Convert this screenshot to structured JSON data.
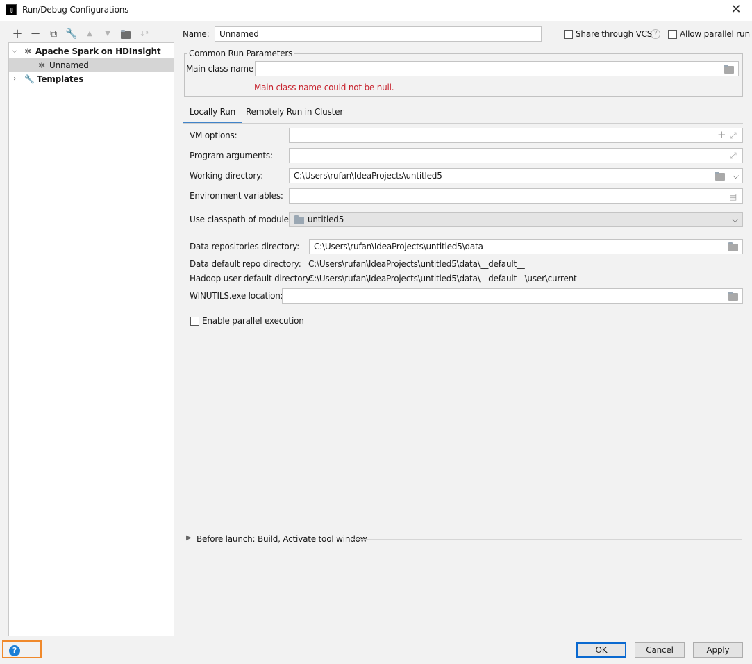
{
  "window": {
    "title": "Run/Debug Configurations",
    "app_icon_text": "IJ",
    "close_glyph": "✕"
  },
  "toolbar": {
    "icons": [
      "add-icon",
      "remove-icon",
      "copy-icon",
      "wrench-icon",
      "move-up-icon",
      "move-down-icon",
      "new-folder-icon",
      "sort-icon"
    ]
  },
  "tree": {
    "items": [
      {
        "label": "Apache Spark on HDInsight",
        "expanded": true
      },
      {
        "label": "Unnamed",
        "selected": true
      },
      {
        "label": "Templates",
        "expanded": false
      }
    ]
  },
  "header": {
    "name_label": "Name:",
    "name_value": "Unnamed",
    "share_vcs_label": "Share through VCS",
    "allow_parallel_label": "Allow parallel run"
  },
  "common": {
    "group_title": "Common Run Parameters",
    "main_class_label": "Main class name",
    "main_class_value": "",
    "error": "Main class name could not be null."
  },
  "tabs": [
    {
      "label": "Locally Run",
      "active": true
    },
    {
      "label": "Remotely Run in Cluster",
      "active": false
    }
  ],
  "local": {
    "vm_options_label": "VM options:",
    "vm_options_value": "",
    "program_args_label": "Program arguments:",
    "program_args_value": "",
    "working_dir_label": "Working directory:",
    "working_dir_value": "C:\\Users\\rufan\\IdeaProjects\\untitled5",
    "env_vars_label": "Environment variables:",
    "env_vars_value": "",
    "classpath_label": "Use classpath of module:",
    "classpath_value": "untitled5",
    "data_repo_label": "Data repositories directory:",
    "data_repo_value": "C:\\Users\\rufan\\IdeaProjects\\untitled5\\data",
    "data_default_label": "Data default repo directory:",
    "data_default_value": "C:\\Users\\rufan\\IdeaProjects\\untitled5\\data\\__default__",
    "hadoop_label": "Hadoop user default directory:",
    "hadoop_value": "C:\\Users\\rufan\\IdeaProjects\\untitled5\\data\\__default__\\user\\current",
    "winutils_label": "WINUTILS.exe location:",
    "winutils_value": "",
    "parallel_label": "Enable parallel execution"
  },
  "before_launch": {
    "label": "Before launch: Build, Activate tool window"
  },
  "buttons": {
    "ok": "OK",
    "cancel": "Cancel",
    "apply": "Apply"
  },
  "help": {
    "glyph": "?"
  },
  "colors": {
    "error": "#c7222d",
    "tab_accent": "#4083c9",
    "help_highlight": "#f0892b",
    "ok_border": "#0a69d0"
  }
}
